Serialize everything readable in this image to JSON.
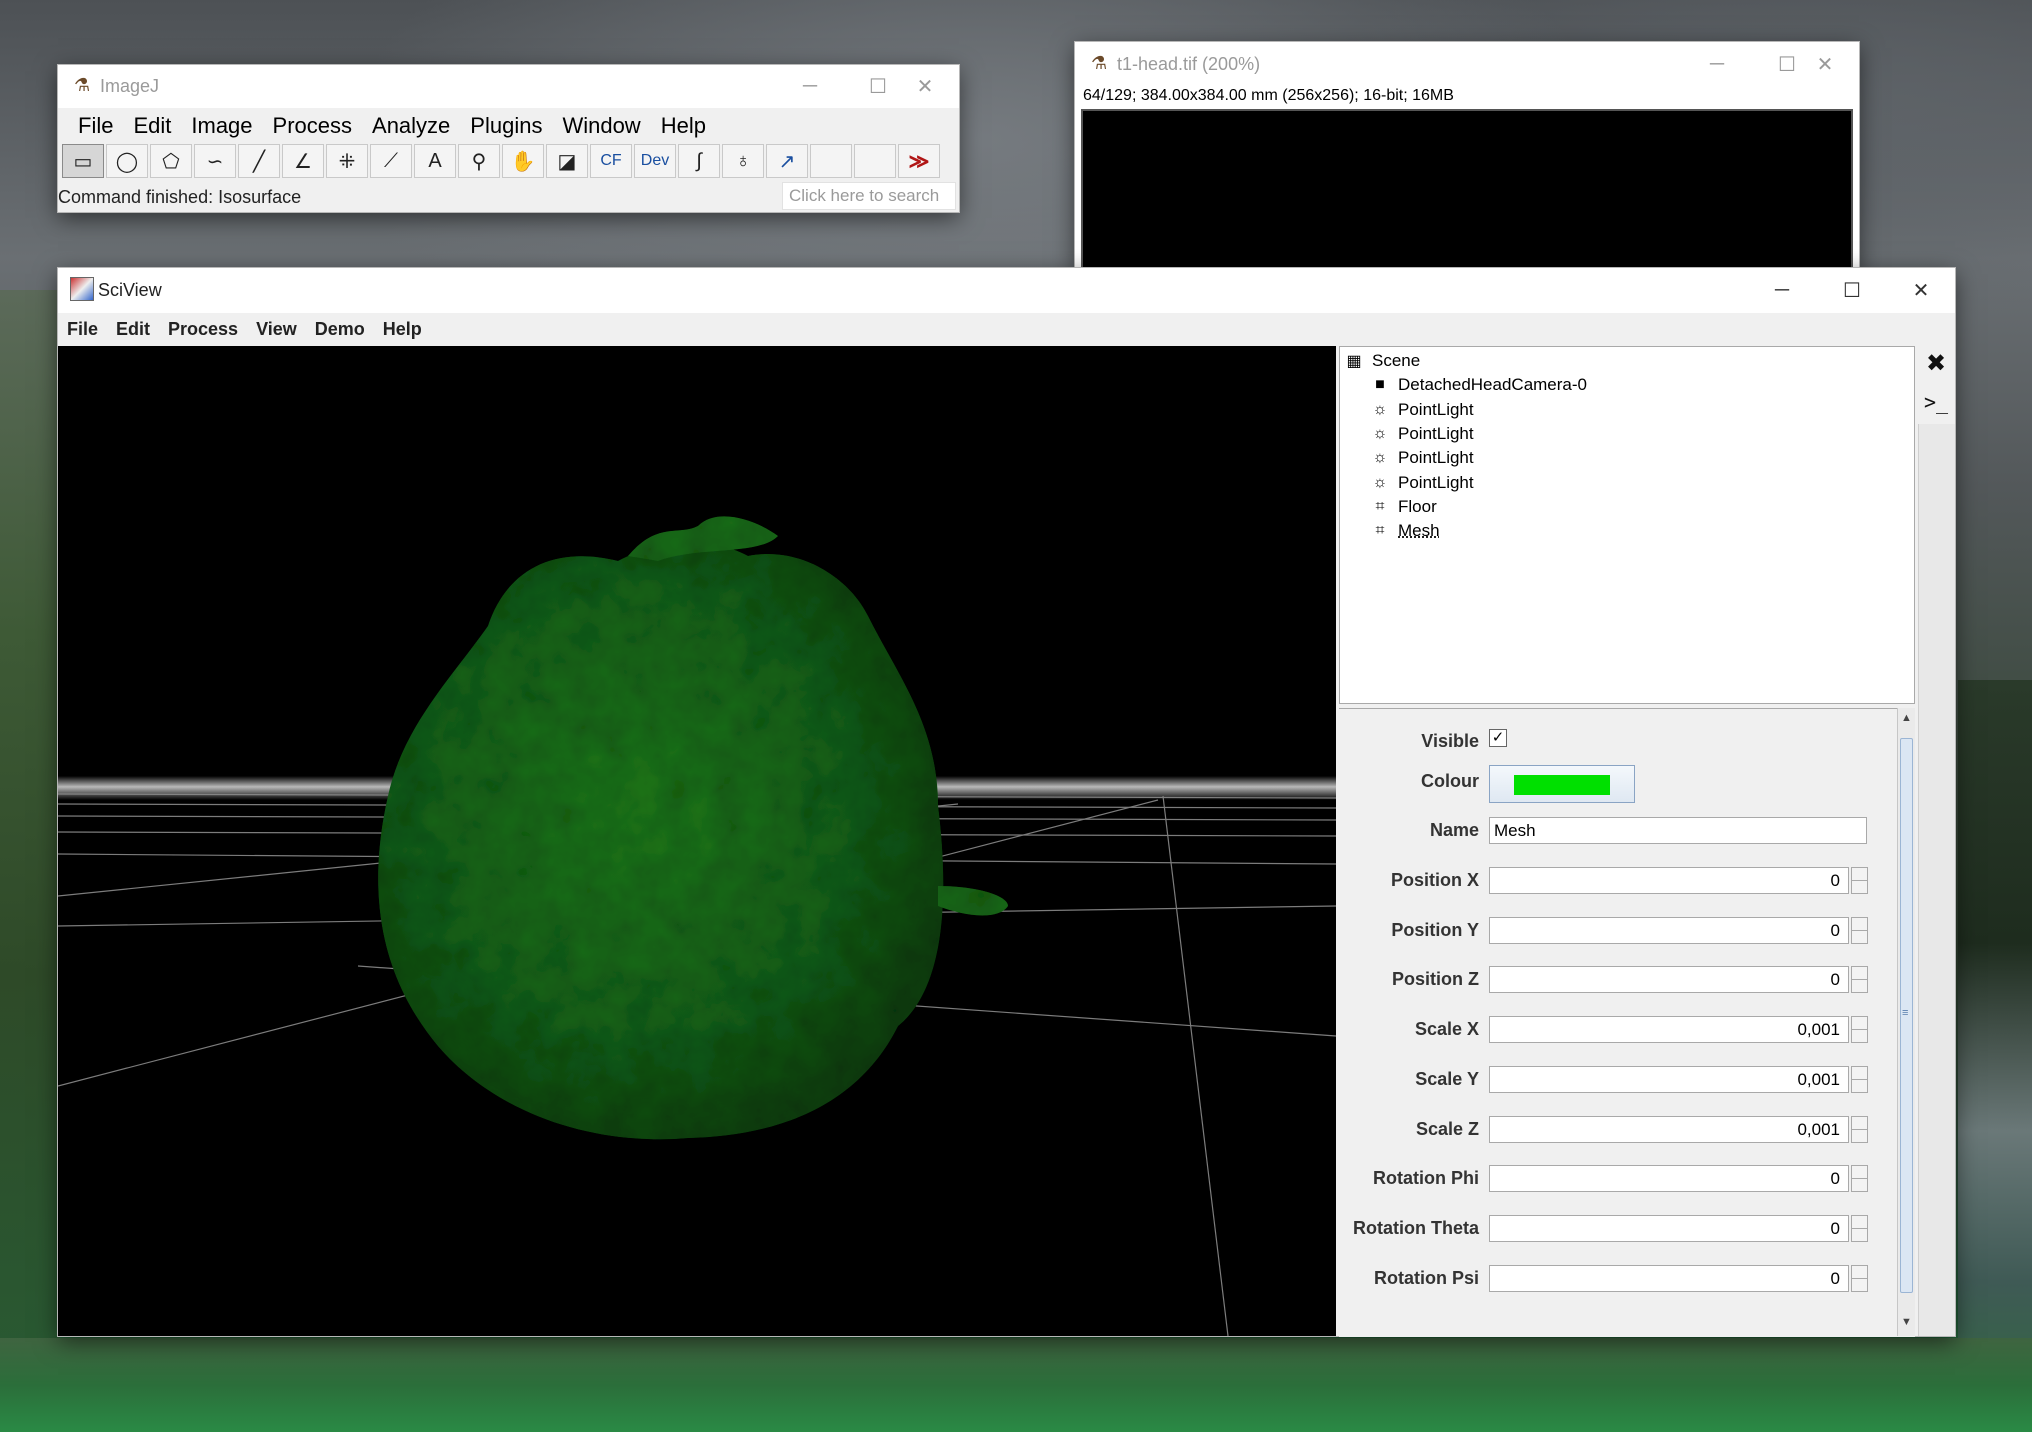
{
  "imagej": {
    "title": "ImageJ",
    "menu": [
      "File",
      "Edit",
      "Image",
      "Process",
      "Analyze",
      "Plugins",
      "Window",
      "Help"
    ],
    "tools": [
      {
        "name": "rectangle-tool-icon",
        "glyph": "▭"
      },
      {
        "name": "oval-tool-icon",
        "glyph": "◯"
      },
      {
        "name": "polygon-tool-icon",
        "glyph": "⬠"
      },
      {
        "name": "freehand-tool-icon",
        "glyph": "∽"
      },
      {
        "name": "line-tool-icon",
        "glyph": "╱"
      },
      {
        "name": "angle-tool-icon",
        "glyph": "∠"
      },
      {
        "name": "multipoint-tool-icon",
        "glyph": "⁜"
      },
      {
        "name": "wand-tool-icon",
        "glyph": "⟋"
      },
      {
        "name": "text-tool-icon",
        "glyph": "A"
      },
      {
        "name": "magnifier-tool-icon",
        "glyph": "⚲"
      },
      {
        "name": "hand-tool-icon",
        "glyph": "✋"
      },
      {
        "name": "color-picker-icon",
        "glyph": "◪"
      },
      {
        "name": "cf-tool-icon",
        "glyph": "CF"
      },
      {
        "name": "dev-tool-icon",
        "glyph": "Dev"
      },
      {
        "name": "pencil-tool-icon",
        "glyph": "∫"
      },
      {
        "name": "flood-fill-icon",
        "glyph": "♁"
      },
      {
        "name": "arrow-tool-icon",
        "glyph": "↗"
      },
      {
        "name": "blank-tool-1",
        "glyph": ""
      },
      {
        "name": "blank-tool-2",
        "glyph": ""
      },
      {
        "name": "more-tools-icon",
        "glyph": "≫"
      }
    ],
    "status": "Command finished: Isosurface",
    "search_placeholder": "Click here to search"
  },
  "t1head": {
    "title": "t1-head.tif (200%)",
    "info": "64/129; 384.00x384.00 mm (256x256); 16-bit; 16MB"
  },
  "sciview": {
    "title": "SciView",
    "menu": [
      "File",
      "Edit",
      "Process",
      "View",
      "Demo",
      "Help"
    ],
    "tree": [
      {
        "label": "Scene",
        "icon": "scene-icon"
      },
      {
        "label": "DetachedHeadCamera-0",
        "icon": "camera-icon"
      },
      {
        "label": "PointLight",
        "icon": "light-icon"
      },
      {
        "label": "PointLight",
        "icon": "light-icon"
      },
      {
        "label": "PointLight",
        "icon": "light-icon"
      },
      {
        "label": "PointLight",
        "icon": "light-icon"
      },
      {
        "label": "Floor",
        "icon": "node-icon"
      },
      {
        "label": "Mesh",
        "icon": "node-icon"
      }
    ],
    "properties": {
      "visible_label": "Visible",
      "visible": true,
      "colour_label": "Colour",
      "colour_value": "#00e000",
      "name_label": "Name",
      "name_value": "Mesh",
      "fields": [
        {
          "label": "Position X",
          "value": "0"
        },
        {
          "label": "Position Y",
          "value": "0"
        },
        {
          "label": "Position Z",
          "value": "0"
        },
        {
          "label": "Scale X",
          "value": "0,001"
        },
        {
          "label": "Scale Y",
          "value": "0,001"
        },
        {
          "label": "Scale Z",
          "value": "0,001"
        },
        {
          "label": "Rotation Phi",
          "value": "0"
        },
        {
          "label": "Rotation Theta",
          "value": "0"
        },
        {
          "label": "Rotation Psi",
          "value": "0"
        }
      ]
    },
    "mesh_color": "#1f7a1a"
  }
}
